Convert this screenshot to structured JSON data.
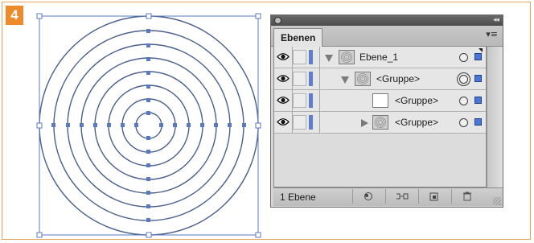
{
  "step": {
    "number": "4"
  },
  "panel": {
    "tab_label": "Ebenen",
    "layers": [
      {
        "name": "Ebene_1",
        "twisty": "expanded",
        "thumb": "rings",
        "indent": 0,
        "target": "normal"
      },
      {
        "name": "<Gruppe>",
        "twisty": "expanded",
        "thumb": "rings",
        "indent": 1,
        "target": "active"
      },
      {
        "name": "<Gruppe>",
        "twisty": "none",
        "thumb": "blank",
        "indent": 2,
        "target": "normal"
      },
      {
        "name": "<Gruppe>",
        "twisty": "collapsed",
        "thumb": "rings",
        "indent": 2,
        "target": "normal"
      }
    ],
    "status": {
      "layer_count": "1 Ebene"
    },
    "icons": {
      "close": "close-icon",
      "collapse": "collapse-panel-icon",
      "menu": "panel-menu-icon",
      "visibility": "eye-icon",
      "locate": "locate-object-icon",
      "clipping": "make-clipping-mask-icon",
      "new_sublayer": "new-sublayer-icon",
      "new_layer": "new-layer-icon",
      "trash": "trash-icon"
    },
    "colors": {
      "layer_color": "#5f7fce",
      "selection": "#4a76d4"
    }
  },
  "colors": {
    "accent": "#ee8a2a",
    "frame": "#e9a35a",
    "artwork_stroke": "#4a5f8c",
    "handle": "#5a7ac0"
  }
}
